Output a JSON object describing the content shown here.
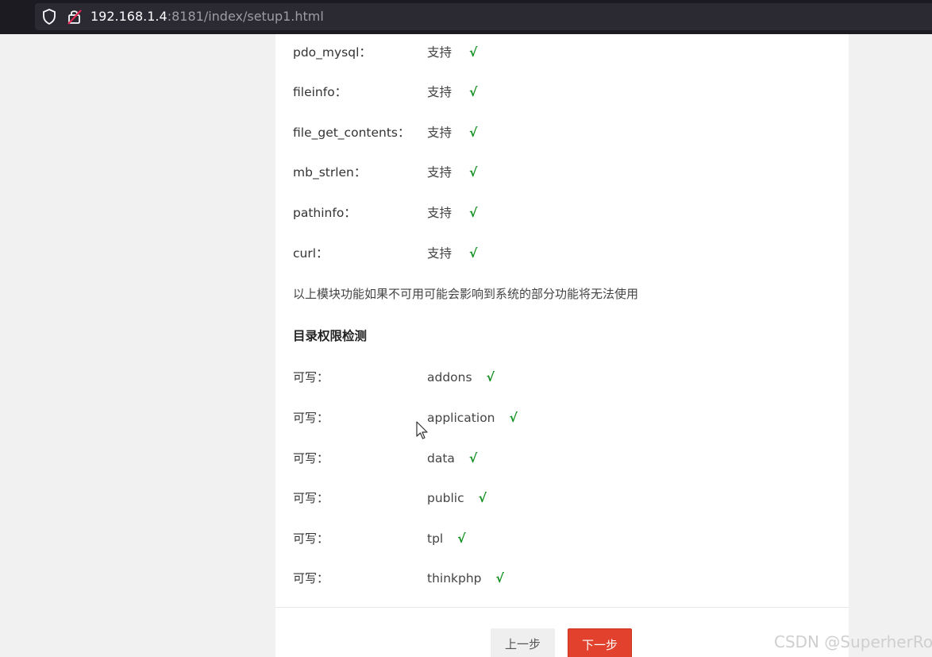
{
  "browser": {
    "url_host": "192.168.1.4",
    "url_rest": ":8181/index/setup1.html"
  },
  "modules": [
    {
      "name": "pdo_mysql：",
      "status": "支持",
      "check": "√"
    },
    {
      "name": "fileinfo：",
      "status": "支持",
      "check": "√"
    },
    {
      "name": "file_get_contents：",
      "status": "支持",
      "check": "√"
    },
    {
      "name": "mb_strlen：",
      "status": "支持",
      "check": "√"
    },
    {
      "name": "pathinfo：",
      "status": "支持",
      "check": "√"
    },
    {
      "name": "curl：",
      "status": "支持",
      "check": "√"
    }
  ],
  "note": "以上模块功能如果不可用可能会影响到系统的部分功能将无法使用",
  "dir_section_title": "目录权限检测",
  "dirs": [
    {
      "label": "可写：",
      "dir": "addons",
      "check": "√"
    },
    {
      "label": "可写：",
      "dir": "application",
      "check": "√"
    },
    {
      "label": "可写：",
      "dir": "data",
      "check": "√"
    },
    {
      "label": "可写：",
      "dir": "public",
      "check": "√"
    },
    {
      "label": "可写：",
      "dir": "tpl",
      "check": "√"
    },
    {
      "label": "可写：",
      "dir": "thinkphp",
      "check": "√"
    }
  ],
  "buttons": {
    "prev": "上一步",
    "next": "下一步"
  },
  "watermark": "CSDN @SuperherRo"
}
